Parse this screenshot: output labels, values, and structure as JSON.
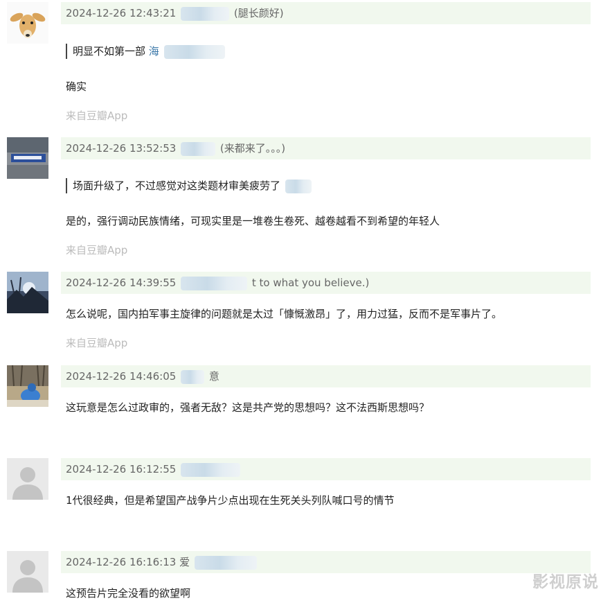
{
  "comments": [
    {
      "timestamp": "2024-12-26 12:43:21",
      "name_tail": "(腿长颜好)",
      "quote": "明显不如第一部",
      "quote_link": "海",
      "reply": "确实",
      "source": "来自豆瓣App",
      "avatar_icon": "deer-avatar"
    },
    {
      "timestamp": "2024-12-26 13:52:53",
      "name_tail": "(来都来了。。。)",
      "quote": "场面升级了，不过感觉对这类题材审美疲劳了",
      "quote_link": "",
      "reply": "是的，强行调动民族情绪，可现实里是一堆卷生卷死、越卷越看不到希望的年轻人",
      "source": "来自豆瓣App",
      "avatar_icon": "photo-avatar"
    },
    {
      "timestamp": "2024-12-26 14:39:55",
      "name_tail": "t to what you believe.)",
      "reply": "怎么说呢，国内拍军事主旋律的问题就是太过「慷慨激昂」了，用力过猛，反而不是军事片了。",
      "source": "来自豆瓣App",
      "avatar_icon": "landscape-avatar"
    },
    {
      "timestamp": "2024-12-26 14:46:05",
      "name_tail": "意",
      "reply": "这玩意是怎么过政审的，强者无敌？这是共产党的思想吗？这不法西斯思想吗？",
      "avatar_icon": "snow-avatar"
    },
    {
      "timestamp": "2024-12-26 16:12:55",
      "name_tail": "",
      "reply": "1代很经典，但是希望国产战争片少点出现在生死关头列队喊口号的情节",
      "avatar_icon": "default-avatar"
    },
    {
      "timestamp": "2024-12-26 16:16:13",
      "name_prefix": "爱",
      "name_tail": "",
      "reply": "这预告片完全没看的欲望啊",
      "avatar_icon": "default-avatar"
    }
  ],
  "watermark": "影视原说",
  "colors": {
    "meta_bg": "#f1f8ee",
    "link": "#3a77a8",
    "muted": "#bbbbbb"
  }
}
